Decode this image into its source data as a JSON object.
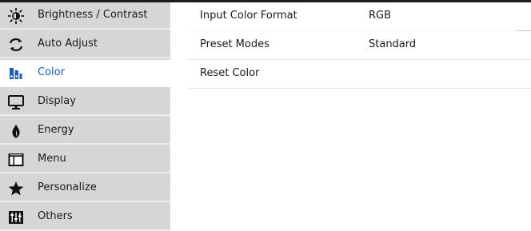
{
  "sidebar": {
    "items": [
      {
        "label": "Brightness / Contrast",
        "icon": "brightness-icon"
      },
      {
        "label": "Auto Adjust",
        "icon": "auto-adjust-icon"
      },
      {
        "label": "Color",
        "icon": "color-palette-icon"
      },
      {
        "label": "Display",
        "icon": "monitor-icon"
      },
      {
        "label": "Energy",
        "icon": "energy-icon"
      },
      {
        "label": "Menu",
        "icon": "menu-icon"
      },
      {
        "label": "Personalize",
        "icon": "star-icon"
      },
      {
        "label": "Others",
        "icon": "sliders-icon"
      }
    ],
    "active_index": 2
  },
  "content": {
    "rows": [
      {
        "label": "Input Color Format",
        "value": "RGB"
      },
      {
        "label": "Preset Modes",
        "value": "Standard"
      },
      {
        "label": "Reset Color",
        "value": ""
      }
    ]
  },
  "colors": {
    "active_text": "#1a5fb4",
    "sidebar_bg": "#d6d6d6",
    "content_bg": "#ffffff"
  }
}
